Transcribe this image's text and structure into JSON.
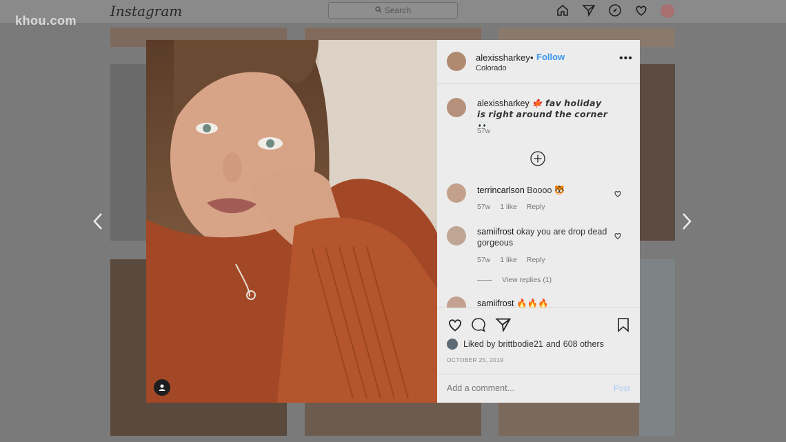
{
  "watermark": "khou.com",
  "topbar": {
    "logo": "Instagram",
    "search_placeholder": "Search",
    "nav_icons": [
      "home-icon",
      "direct-icon",
      "explore-icon",
      "activity-heart-icon",
      "profile-avatar"
    ]
  },
  "post": {
    "author": "alexissharkey",
    "separator": "•",
    "follow_label": "Follow",
    "location": "Colorado",
    "more": "•••",
    "caption": {
      "username": "alexissharkey",
      "text": "🍁 𝙛𝙖𝙫 𝙝𝙤𝙡𝙞𝙙𝙖𝙮 𝙞𝙨 𝙧𝙞𝙜𝙝𝙩 𝙖𝙧𝙤𝙪𝙣𝙙 𝙩𝙝𝙚 𝙘𝙤𝙧𝙣𝙚𝙧 👀",
      "age": "57w"
    },
    "comments": [
      {
        "username": "terrincarlson",
        "text": "Boooo 🐯",
        "age": "57w",
        "likes": "1 like",
        "reply": "Reply"
      },
      {
        "username": "samiifrost",
        "text": "okay you are drop dead gorgeous",
        "age": "57w",
        "likes": "1 like",
        "reply": "Reply"
      },
      {
        "username": "samiifrost",
        "text": "🔥🔥🔥"
      }
    ],
    "view_replies": "View replies (1)",
    "liked_by_prefix": "Liked by",
    "liked_by_user": "brittbodie21",
    "liked_by_and": "and",
    "liked_by_others": "608 others",
    "date": "OCTOBER 25, 2019",
    "add_comment_placeholder": "Add a comment...",
    "post_button": "Post"
  },
  "colors": {
    "accent": "#3897f0",
    "post_disabled": "#a9cdf3"
  }
}
